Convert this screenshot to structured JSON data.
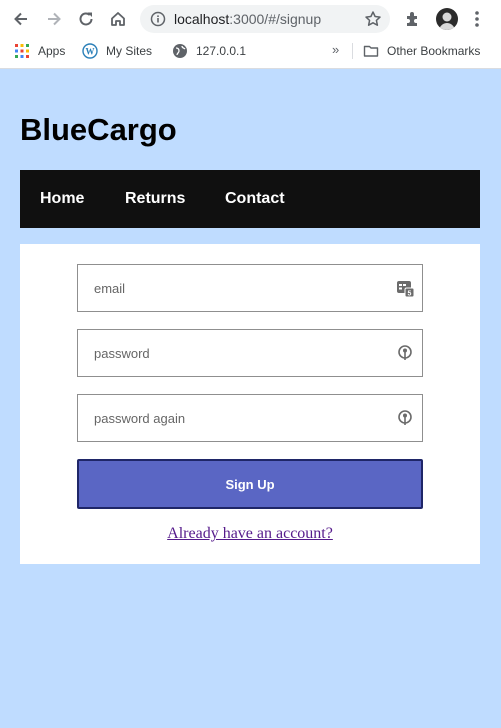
{
  "browser": {
    "url_host": "localhost",
    "url_path": ":3000/#/signup",
    "bookmarks": [
      {
        "label": "Apps"
      },
      {
        "label": "My Sites"
      },
      {
        "label": "127.0.0.1"
      }
    ],
    "more_bookmarks": "»",
    "other_bookmarks": "Other Bookmarks"
  },
  "site": {
    "title": "BlueCargo",
    "nav": [
      {
        "label": "Home"
      },
      {
        "label": "Returns"
      },
      {
        "label": "Contact"
      }
    ]
  },
  "form": {
    "email_placeholder": "email",
    "password_placeholder": "password",
    "password_again_placeholder": "password again",
    "submit_label": "Sign Up",
    "login_link": "Already have an account?"
  },
  "colors": {
    "page_bg": "#bfdcff",
    "navbar_bg": "#101010",
    "button_bg": "#5a66c4",
    "link": "#551a8b"
  }
}
